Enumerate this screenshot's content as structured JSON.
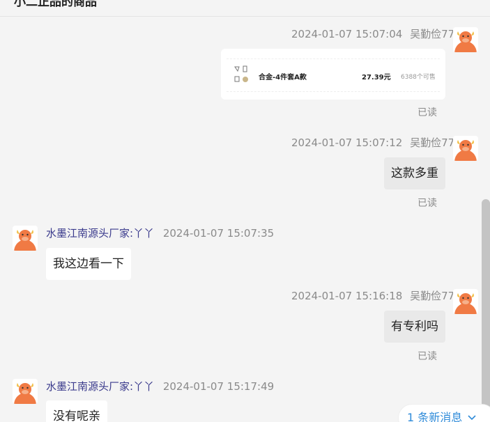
{
  "header": {
    "title": "小二正品的商品"
  },
  "messages": [
    {
      "side": "self",
      "time": "2024-01-07 15:07:04",
      "sender": "吴勤俭77",
      "type": "product",
      "status": "已读",
      "product": {
        "name": "合金-4件套A款",
        "price": "27.39元",
        "sold": "6388个可售"
      }
    },
    {
      "side": "self",
      "time": "2024-01-07 15:07:12",
      "sender": "吴勤俭77",
      "text": "这款多重",
      "status": "已读"
    },
    {
      "side": "other",
      "sender": "水墨江南源头厂家:丫丫",
      "time": "2024-01-07 15:07:35",
      "text": "我这边看一下"
    },
    {
      "side": "self",
      "time": "2024-01-07 15:16:18",
      "sender": "吴勤俭77",
      "text": "有专利吗",
      "status": "已读"
    },
    {
      "side": "other",
      "sender": "水墨江南源头厂家:丫丫",
      "time": "2024-01-07 15:17:49",
      "text": "没有呢亲"
    }
  ],
  "new_message_notice": {
    "label": "1 条新消息",
    "icon": "chevron-down-icon"
  },
  "icons": {
    "avatar": "cow-avatar-icon"
  },
  "colors": {
    "accent": "#2f8bd9",
    "avatar": "#f07a44",
    "page_bg": "#f4f4f4"
  }
}
